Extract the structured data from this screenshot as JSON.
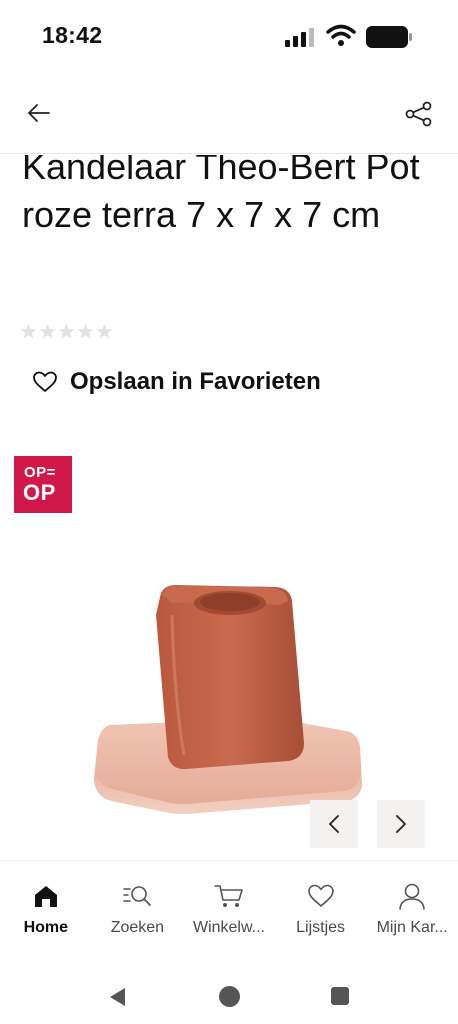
{
  "status_bar": {
    "time": "18:42"
  },
  "header": {
    "back_icon": "arrow-left-icon",
    "share_icon": "share-icon"
  },
  "product": {
    "title": "Kandelaar Theo-Bert Pot roze terra 7 x 7 x 7 cm",
    "rating": {
      "stars_total": 5,
      "stars_filled": 0
    },
    "favorite_label": "Opslaan in Favorieten",
    "brand_badge": {
      "line1": "OP=",
      "line2": "OP",
      "color": "#d0194a"
    }
  },
  "carousel": {
    "prev_icon": "chevron-left-icon",
    "next_icon": "chevron-right-icon"
  },
  "tab_bar": {
    "items": [
      {
        "label": "Home",
        "icon": "home-icon",
        "active": true
      },
      {
        "label": "Zoeken",
        "icon": "search-icon",
        "active": false
      },
      {
        "label": "Winkelw...",
        "icon": "cart-icon",
        "active": false
      },
      {
        "label": "Lijstjes",
        "icon": "heart-icon",
        "active": false
      },
      {
        "label": "Mijn Kar...",
        "icon": "user-icon",
        "active": false
      }
    ]
  },
  "colors": {
    "accent": "#d0194a",
    "product_terra": "#c0644a",
    "product_base": "#e8b3a0"
  }
}
